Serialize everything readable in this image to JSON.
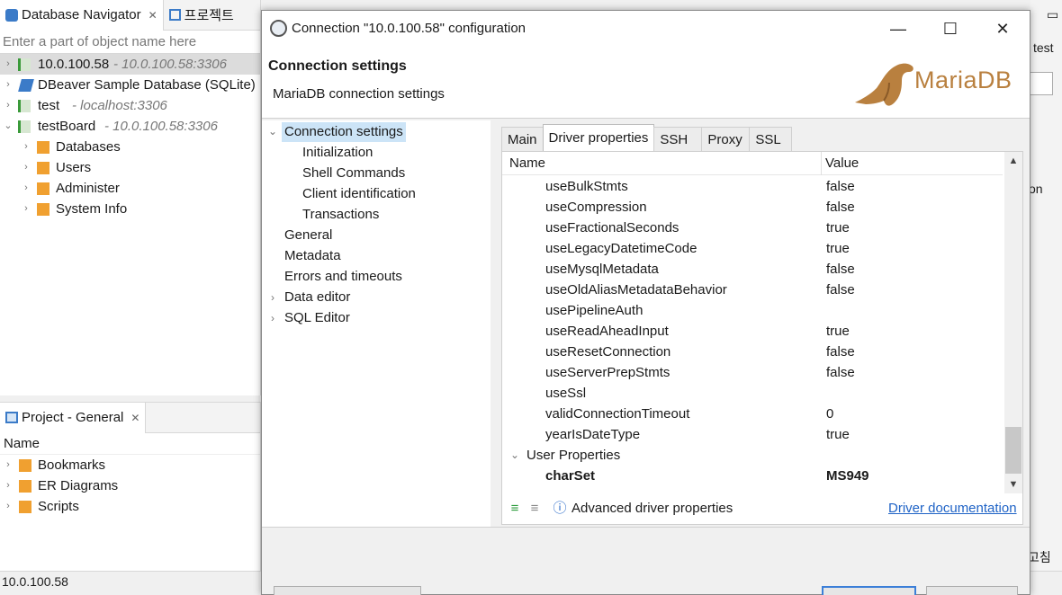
{
  "navigator": {
    "tab_label": "Database Navigator",
    "tab2_label": "프로젝트",
    "search_placeholder": "Enter a part of object name here",
    "items": [
      {
        "label": "10.0.100.58",
        "sub": "- 10.0.100.58:3306"
      },
      {
        "label": "DBeaver Sample Database (SQLite)",
        "sub": ""
      },
      {
        "label": "test",
        "sub": "- localhost:3306"
      },
      {
        "label": "testBoard",
        "sub": "- 10.0.100.58:3306"
      },
      {
        "label": "Databases"
      },
      {
        "label": "Users"
      },
      {
        "label": "Administer"
      },
      {
        "label": "System Info"
      }
    ]
  },
  "project": {
    "tab_label": "Project - General",
    "header": "Name",
    "items": [
      {
        "label": "Bookmarks"
      },
      {
        "label": "ER Diagrams"
      },
      {
        "label": "Scripts"
      }
    ]
  },
  "statusbar": {
    "text": "10.0.100.58"
  },
  "right_partial": {
    "test": "test",
    "on": "on",
    "refresh": "고침"
  },
  "dialog": {
    "title": "Connection \"10.0.100.58\" configuration",
    "header_title": "Connection settings",
    "header_sub": "MariaDB connection settings",
    "logo_text": "MariaDB",
    "tree": [
      {
        "label": "Connection settings"
      },
      {
        "label": "Initialization"
      },
      {
        "label": "Shell Commands"
      },
      {
        "label": "Client identification"
      },
      {
        "label": "Transactions"
      },
      {
        "label": "General"
      },
      {
        "label": "Metadata"
      },
      {
        "label": "Errors and timeouts"
      },
      {
        "label": "Data editor"
      },
      {
        "label": "SQL Editor"
      }
    ],
    "tabs": [
      "Main",
      "Driver properties",
      "SSH",
      "Proxy",
      "SSL"
    ],
    "grid": {
      "col_name": "Name",
      "col_value": "Value",
      "rows": [
        {
          "name": "useBulkStmts",
          "value": "false"
        },
        {
          "name": "useCompression",
          "value": "false"
        },
        {
          "name": "useFractionalSeconds",
          "value": "true"
        },
        {
          "name": "useLegacyDatetimeCode",
          "value": "true"
        },
        {
          "name": "useMysqlMetadata",
          "value": "false"
        },
        {
          "name": "useOldAliasMetadataBehavior",
          "value": "false"
        },
        {
          "name": "usePipelineAuth",
          "value": ""
        },
        {
          "name": "useReadAheadInput",
          "value": "true"
        },
        {
          "name": "useResetConnection",
          "value": "false"
        },
        {
          "name": "useServerPrepStmts",
          "value": "false"
        },
        {
          "name": "useSsl",
          "value": ""
        },
        {
          "name": "validConnectionTimeout",
          "value": "0"
        },
        {
          "name": "yearIsDateType",
          "value": "true"
        }
      ],
      "group": "User Properties",
      "user_row": {
        "name": "charSet",
        "value": "MS949"
      }
    },
    "advanced_label": "Advanced driver properties",
    "doc_link": "Driver documentation"
  },
  "colors": {
    "accent": "#3c7fd8",
    "link": "#1f63c6",
    "logo": "#b9803f",
    "selection": "#cce4f7"
  }
}
